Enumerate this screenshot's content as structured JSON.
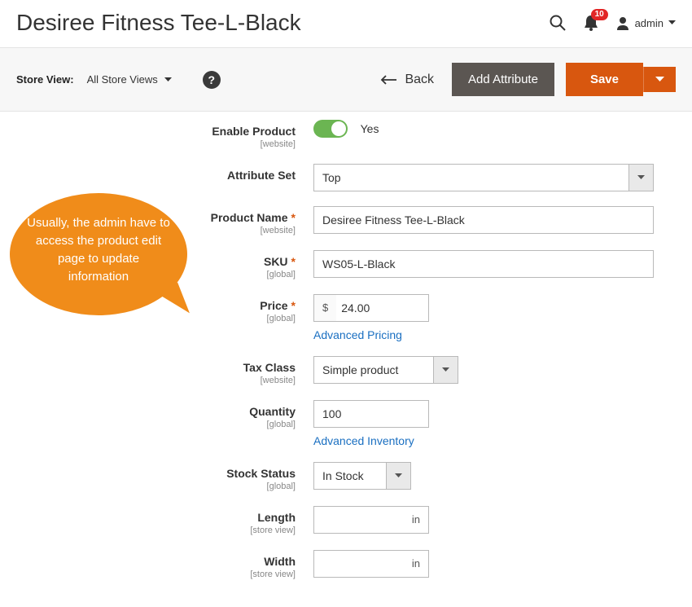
{
  "header": {
    "title": "Desiree Fitness Tee-L-Black",
    "notifications_count": "10",
    "user_label": "admin"
  },
  "toolbar": {
    "store_view_label": "Store View:",
    "store_view_value": "All Store Views",
    "back_label": "Back",
    "add_attribute_label": "Add Attribute",
    "save_label": "Save"
  },
  "form": {
    "enable": {
      "label": "Enable Product",
      "scope": "[website]",
      "value_text": "Yes"
    },
    "attribute_set": {
      "label": "Attribute Set",
      "value": "Top"
    },
    "product_name": {
      "label": "Product Name",
      "scope": "[website]",
      "value": "Desiree Fitness Tee-L-Black"
    },
    "sku": {
      "label": "SKU",
      "scope": "[global]",
      "value": "WS05-L-Black"
    },
    "price": {
      "label": "Price",
      "scope": "[global]",
      "currency": "$",
      "value": "24.00",
      "advanced_link": "Advanced Pricing"
    },
    "tax_class": {
      "label": "Tax Class",
      "scope": "[website]",
      "value": "Simple product"
    },
    "quantity": {
      "label": "Quantity",
      "scope": "[global]",
      "value": "100",
      "advanced_link": "Advanced Inventory"
    },
    "stock_status": {
      "label": "Stock Status",
      "scope": "[global]",
      "value": "In Stock"
    },
    "length": {
      "label": "Length",
      "scope": "[store view]",
      "unit": "in",
      "value": ""
    },
    "width": {
      "label": "Width",
      "scope": "[store view]",
      "unit": "in",
      "value": ""
    }
  },
  "callout": {
    "text": "Usually, the admin have to access the product edit page to update information"
  }
}
